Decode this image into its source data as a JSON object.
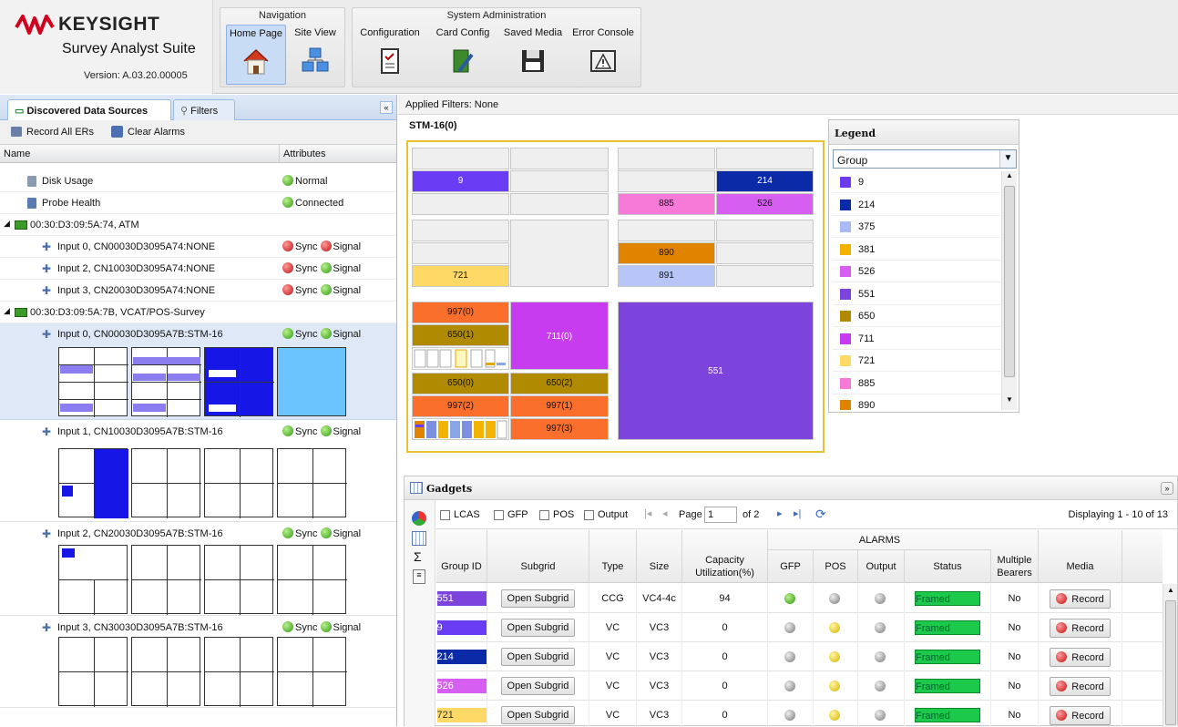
{
  "header": {
    "brand": "KEYSIGHT",
    "product": "Survey Analyst Suite",
    "version": "Version: A.03.20.00005",
    "navigation": {
      "title": "Navigation",
      "buttons": [
        {
          "label": "Home Page",
          "icon": "house-icon"
        },
        {
          "label": "Site View",
          "icon": "site-view-icon"
        }
      ]
    },
    "system_admin": {
      "title": "System Administration",
      "buttons": [
        {
          "label": "Configuration",
          "icon": "configuration-icon"
        },
        {
          "label": "Card Config",
          "icon": "card-config-icon"
        },
        {
          "label": "Saved Media",
          "icon": "floppy-disk-icon"
        },
        {
          "label": "Error Console",
          "icon": "warning-icon"
        }
      ]
    }
  },
  "left_panel": {
    "tabs": [
      {
        "label": "Discovered Data Sources",
        "icon": "data-sources-icon"
      },
      {
        "label": "Filters",
        "icon": "filter-icon"
      }
    ],
    "toolbar": {
      "record_all": "Record All ERs",
      "clear_alarms": "Clear Alarms"
    },
    "columns": {
      "name": "Name",
      "attributes": "Attributes"
    },
    "rows": [
      {
        "name": "Disk Usage",
        "status1": "Normal"
      },
      {
        "name": "Probe Health",
        "status1": "Connected"
      },
      {
        "name": "00:30:D3:09:5A:74, ATM"
      },
      {
        "name": "Input 0, CN00030D3095A74:NONE",
        "status1": "Sync",
        "status2": "Signal"
      },
      {
        "name": "Input 2, CN10030D3095A74:NONE",
        "status1": "Sync",
        "status2": "Signal"
      },
      {
        "name": "Input 3, CN20030D3095A74:NONE",
        "status1": "Sync",
        "status2": "Signal"
      },
      {
        "name": "00:30:D3:09:5A:7B, VCAT/POS-Survey"
      },
      {
        "name": "Input 0, CN00030D3095A7B:STM-16",
        "status1": "Sync",
        "status2": "Signal"
      },
      {
        "name": "Input 1, CN10030D3095A7B:STM-16",
        "status1": "Sync",
        "status2": "Signal"
      },
      {
        "name": "Input 2, CN20030D3095A7B:STM-16",
        "status1": "Sync",
        "status2": "Signal"
      },
      {
        "name": "Input 3, CN30030D3095A7B:STM-16",
        "status1": "Sync",
        "status2": "Signal"
      }
    ]
  },
  "applied_filters": "Applied Filters: None",
  "stm_title": "STM-16(0)",
  "grid_labels": {
    "a": "9",
    "b": "214",
    "c": "885",
    "d": "526",
    "e": "890",
    "f": "721",
    "g": "891",
    "h": "997(0)",
    "i": "650(1)",
    "j": "711(0)",
    "k": "551",
    "l": "650(0)",
    "m": "650(2)",
    "n": "997(2)",
    "o": "997(1)",
    "p": "997(3)"
  },
  "legend": {
    "title": "Legend",
    "select_value": "Group",
    "items": [
      {
        "label": "9",
        "color": "#6a3df5"
      },
      {
        "label": "214",
        "color": "#0a2aa8"
      },
      {
        "label": "375",
        "color": "#a9b9f5"
      },
      {
        "label": "381",
        "color": "#f2b400"
      },
      {
        "label": "526",
        "color": "#d65ff2"
      },
      {
        "label": "551",
        "color": "#7d44dd"
      },
      {
        "label": "650",
        "color": "#b08a00"
      },
      {
        "label": "711",
        "color": "#c83cf0"
      },
      {
        "label": "721",
        "color": "#ffd966"
      },
      {
        "label": "885",
        "color": "#f77ad8"
      },
      {
        "label": "890",
        "color": "#e08400"
      }
    ]
  },
  "gadgets": {
    "title": "Gadgets",
    "filters": [
      "LCAS",
      "GFP",
      "POS",
      "Output"
    ],
    "page_label": "Page",
    "page_value": "1",
    "page_of": "of 2",
    "displaying": "Displaying 1 - 10 of 13",
    "alarms_header": "ALARMS",
    "columns": [
      "Group ID",
      "Subgrid",
      "Type",
      "Size",
      "Capacity Utilization(%)",
      "GFP",
      "POS",
      "Output",
      "Status",
      "Multiple Bearers",
      "Media"
    ],
    "rows": [
      {
        "id": "551",
        "color": "#7d44dd",
        "subgrid": "Open Subgrid",
        "type": "CCG",
        "size": "VC4-4c",
        "cap": "94",
        "gfp": "green",
        "pos": "gray",
        "out": "gray",
        "status": "Framed",
        "multi": "No",
        "media": "Record"
      },
      {
        "id": "9",
        "color": "#6a3df5",
        "subgrid": "Open Subgrid",
        "type": "VC",
        "size": "VC3",
        "cap": "0",
        "gfp": "gray",
        "pos": "yellow",
        "out": "gray",
        "status": "Framed",
        "multi": "No",
        "media": "Record"
      },
      {
        "id": "214",
        "color": "#0a2aa8",
        "subgrid": "Open Subgrid",
        "type": "VC",
        "size": "VC3",
        "cap": "0",
        "gfp": "gray",
        "pos": "yellow",
        "out": "gray",
        "status": "Framed",
        "multi": "No",
        "media": "Record"
      },
      {
        "id": "526",
        "color": "#d65ff2",
        "subgrid": "Open Subgrid",
        "type": "VC",
        "size": "VC3",
        "cap": "0",
        "gfp": "gray",
        "pos": "yellow",
        "out": "gray",
        "status": "Framed",
        "multi": "No",
        "media": "Record"
      },
      {
        "id": "721",
        "color": "#ffd966",
        "subgrid": "Open Subgrid",
        "type": "VC",
        "size": "VC3",
        "cap": "0",
        "gfp": "gray",
        "pos": "yellow",
        "out": "gray",
        "status": "Framed",
        "multi": "No",
        "media": "Record"
      }
    ]
  }
}
